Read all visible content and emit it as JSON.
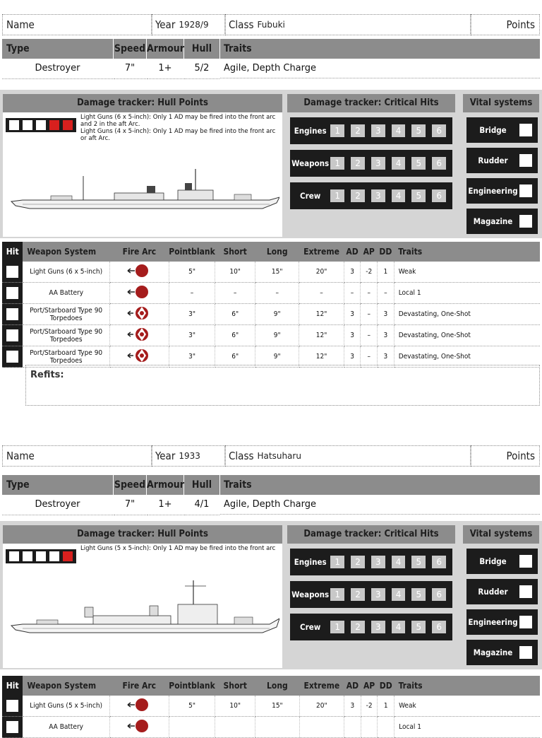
{
  "labels": {
    "name": "Name",
    "year": "Year",
    "class": "Class",
    "points": "Points",
    "type": "Type",
    "speed": "Speed",
    "armour": "Armour",
    "hull": "Hull",
    "traits": "Traits",
    "hull_tracker": "Damage tracker: Hull Points",
    "crit_tracker": "Damage tracker: Critical Hits",
    "vital_systems": "Vital systems",
    "refits": "Refits:",
    "weapon_headers": [
      "Hit",
      "Weapon System",
      "Fire Arc",
      "Pointblank",
      "Short",
      "Long",
      "Extreme",
      "AD",
      "AP",
      "DD",
      "Traits"
    ],
    "crit_rows": [
      "Engines",
      "Weapons",
      "Crew"
    ],
    "crit_numbers": [
      "1",
      "2",
      "3",
      "4",
      "5",
      "6"
    ],
    "vitals": [
      "Bridge",
      "Rudder",
      "Engineering",
      "Magazine"
    ]
  },
  "colors": {
    "header_gray": "#8c8c8c",
    "panel_bg": "#d5d5d5",
    "dark": "#1c1c1c",
    "damage_red": "#d8201e",
    "arc_red": "#a51c1c"
  },
  "cards": [
    {
      "year": "1928/9",
      "class_name": "Fubuki",
      "type": "Destroyer",
      "speed": "7\"",
      "armour": "1+",
      "hull": "5/2",
      "traits": "Agile, Depth Charge",
      "hull_points": [
        "white",
        "white",
        "white",
        "red",
        "red"
      ],
      "hull_note": "Light Guns (6 x 5-inch): Only 1 AD may be fired into the front arc and 2 in the aft Arc.\nLight Guns (4 x 5-inch): Only 1 AD may be fired into the front arc or aft Arc.",
      "weapons": [
        {
          "name": "Light Guns (6 x 5-inch)",
          "arc": "turret",
          "pb": "5\"",
          "short": "10\"",
          "long": "15\"",
          "extreme": "20\"",
          "ad": "3",
          "ap": "-2",
          "dd": "1",
          "traits": "Weak"
        },
        {
          "name": "AA Battery",
          "arc": "turret",
          "pb": "–",
          "short": "–",
          "long": "–",
          "extreme": "–",
          "ad": "–",
          "ap": "–",
          "dd": "–",
          "traits": "Local 1"
        },
        {
          "name": "Port/Starboard Type 90 Torpedoes",
          "arc": "broadside",
          "pb": "3\"",
          "short": "6\"",
          "long": "9\"",
          "extreme": "12\"",
          "ad": "3",
          "ap": "–",
          "dd": "3",
          "traits": "Devastating, One-Shot"
        },
        {
          "name": "Port/Starboard Type 90 Torpedoes",
          "arc": "broadside",
          "pb": "3\"",
          "short": "6\"",
          "long": "9\"",
          "extreme": "12\"",
          "ad": "3",
          "ap": "–",
          "dd": "3",
          "traits": "Devastating, One-Shot"
        },
        {
          "name": "Port/Starboard Type 90 Torpedoes",
          "arc": "broadside",
          "pb": "3\"",
          "short": "6\"",
          "long": "9\"",
          "extreme": "12\"",
          "ad": "3",
          "ap": "–",
          "dd": "3",
          "traits": "Devastating, One-Shot"
        }
      ]
    },
    {
      "year": "1933",
      "class_name": "Hatsuharu",
      "type": "Destroyer",
      "speed": "7\"",
      "armour": "1+",
      "hull": "4/1",
      "traits": "Agile, Depth Charge",
      "hull_points": [
        "white",
        "white",
        "white",
        "white",
        "red"
      ],
      "hull_note": "Light Guns (5 x 5-inch): Only 1 AD may be fired into the front arc",
      "weapons": [
        {
          "name": "Light Guns (5 x 5-inch)",
          "arc": "turret",
          "pb": "5\"",
          "short": "10\"",
          "long": "15\"",
          "extreme": "20\"",
          "ad": "3",
          "ap": "-2",
          "dd": "1",
          "traits": "Weak"
        },
        {
          "name": "AA Battery",
          "arc": "turret",
          "pb": "",
          "short": "",
          "long": "",
          "extreme": "",
          "ad": "",
          "ap": "",
          "dd": "",
          "traits": "Local 1"
        }
      ]
    }
  ]
}
